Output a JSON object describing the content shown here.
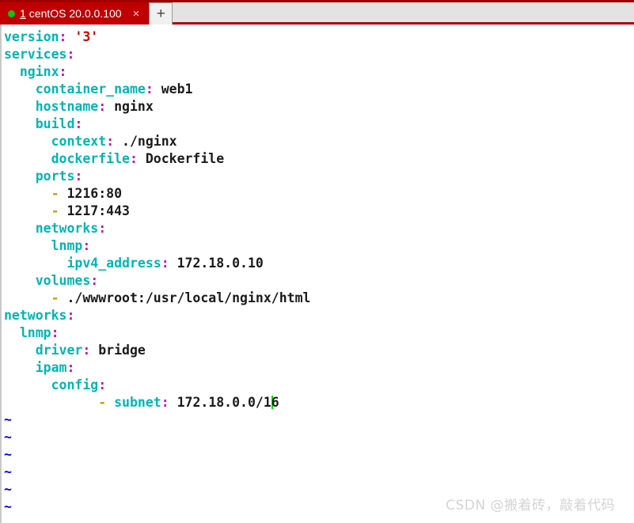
{
  "tabbar": {
    "active_tab": {
      "status_dot": "green",
      "index": "1",
      "title": "centOS 20.0.0.100",
      "close_label": "×"
    },
    "new_tab_label": "+"
  },
  "terminal": {
    "editor": "vim",
    "cursor": {
      "line": 21,
      "column": 32,
      "color": "#00d800"
    },
    "lines": [
      {
        "n": 1,
        "indent": 0,
        "key": "version",
        "value": "'3'",
        "value_kind": "string",
        "dash": false
      },
      {
        "n": 2,
        "indent": 0,
        "key": "services",
        "value": "",
        "value_kind": "none",
        "dash": false
      },
      {
        "n": 3,
        "indent": 2,
        "key": "nginx",
        "value": "",
        "value_kind": "none",
        "dash": false
      },
      {
        "n": 4,
        "indent": 4,
        "key": "container_name",
        "value": "web1",
        "value_kind": "plain",
        "dash": false
      },
      {
        "n": 5,
        "indent": 4,
        "key": "hostname",
        "value": "nginx",
        "value_kind": "plain",
        "dash": false
      },
      {
        "n": 6,
        "indent": 4,
        "key": "build",
        "value": "",
        "value_kind": "none",
        "dash": false
      },
      {
        "n": 7,
        "indent": 6,
        "key": "context",
        "value": "./nginx",
        "value_kind": "plain",
        "dash": false
      },
      {
        "n": 8,
        "indent": 6,
        "key": "dockerfile",
        "value": "Dockerfile",
        "value_kind": "plain",
        "dash": false
      },
      {
        "n": 9,
        "indent": 4,
        "key": "ports",
        "value": "",
        "value_kind": "none",
        "dash": false
      },
      {
        "n": 10,
        "indent": 6,
        "key": "",
        "value": "1216:80",
        "value_kind": "plain",
        "dash": true
      },
      {
        "n": 11,
        "indent": 6,
        "key": "",
        "value": "1217:443",
        "value_kind": "plain",
        "dash": true
      },
      {
        "n": 12,
        "indent": 4,
        "key": "networks",
        "value": "",
        "value_kind": "none",
        "dash": false
      },
      {
        "n": 13,
        "indent": 6,
        "key": "lnmp",
        "value": "",
        "value_kind": "none",
        "dash": false
      },
      {
        "n": 14,
        "indent": 8,
        "key": "ipv4_address",
        "value": "172.18.0.10",
        "value_kind": "plain",
        "dash": false
      },
      {
        "n": 15,
        "indent": 4,
        "key": "volumes",
        "value": "",
        "value_kind": "none",
        "dash": false
      },
      {
        "n": 16,
        "indent": 6,
        "key": "",
        "value": "./wwwroot:/usr/local/nginx/html",
        "value_kind": "plain",
        "dash": true
      },
      {
        "n": 17,
        "indent": 0,
        "key": "networks",
        "value": "",
        "value_kind": "none",
        "dash": false
      },
      {
        "n": 18,
        "indent": 2,
        "key": "lnmp",
        "value": "",
        "value_kind": "none",
        "dash": false
      },
      {
        "n": 19,
        "indent": 4,
        "key": "driver",
        "value": "bridge",
        "value_kind": "plain",
        "dash": false
      },
      {
        "n": 20,
        "indent": 4,
        "key": "ipam",
        "value": "",
        "value_kind": "none",
        "dash": false
      },
      {
        "n": 21,
        "indent": 6,
        "key": "config",
        "value": "",
        "value_kind": "none",
        "dash": false
      },
      {
        "n": 22,
        "indent": 12,
        "key": "subnet",
        "value": "172.18.0.0/16",
        "value_kind": "cursor",
        "dash": true,
        "cursor_before_last": 1
      }
    ],
    "empty_markers": [
      "~",
      "~",
      "~",
      "~",
      "~",
      "~"
    ]
  },
  "watermark": {
    "text": "CSDN @搬着砖，敲着代码"
  }
}
